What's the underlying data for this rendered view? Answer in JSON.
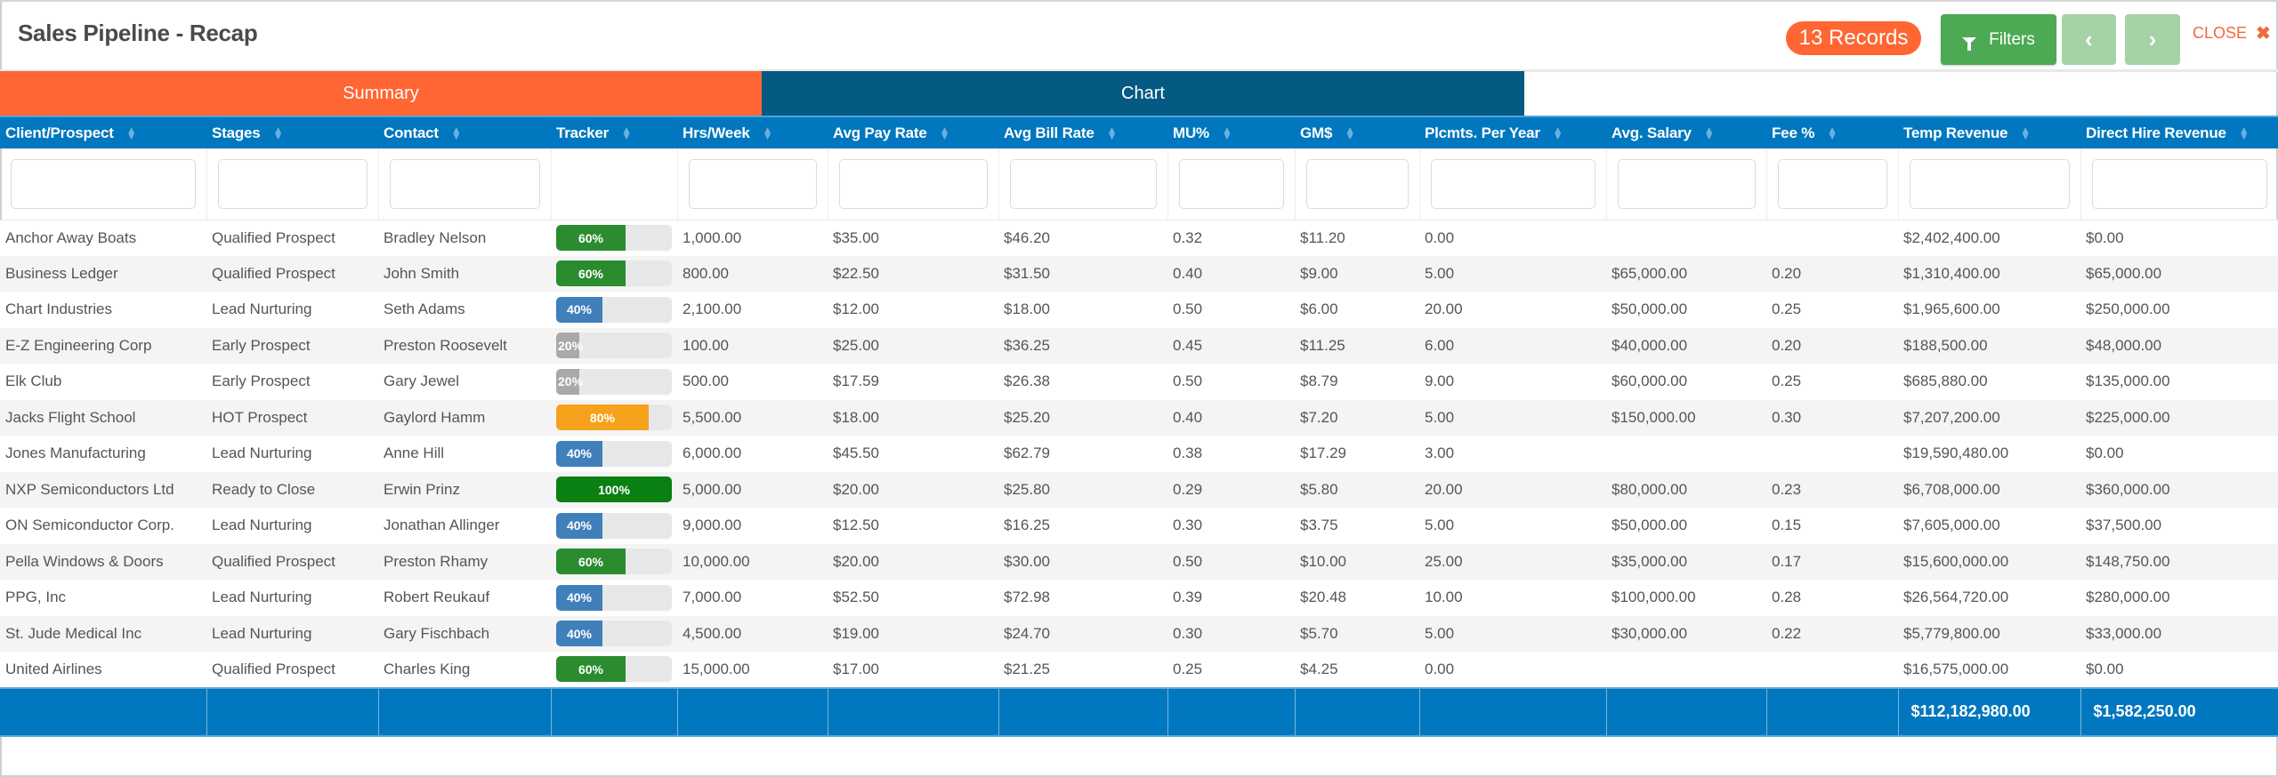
{
  "header": {
    "title": "Sales Pipeline - Recap",
    "records_badge": "13 Records",
    "filters_label": "Filters",
    "prev_glyph": "‹",
    "next_glyph": "›",
    "close_label": "CLOSE",
    "close_glyph": "✖"
  },
  "tabs": [
    {
      "label": "Summary",
      "active": true
    },
    {
      "label": "Chart",
      "active": false
    }
  ],
  "colors": {
    "accent_orange": "#ff6633",
    "chart_tab": "#055a83",
    "table_header": "#0077be",
    "filters_green": "#4caa55",
    "nav_disabled_green": "#a3d3a7"
  },
  "table": {
    "columns": [
      "Client/Prospect",
      "Stages",
      "Contact",
      "Tracker",
      "Hrs/Week",
      "Avg Pay Rate",
      "Avg Bill Rate",
      "MU%",
      "GM$",
      "Plcmts. Per Year",
      "Avg. Salary",
      "Fee %",
      "Temp Revenue",
      "Direct Hire Revenue"
    ],
    "sortable": [
      true,
      true,
      true,
      true,
      true,
      true,
      true,
      true,
      true,
      true,
      true,
      true,
      true,
      true
    ],
    "filter_columns": [
      true,
      true,
      true,
      false,
      true,
      true,
      true,
      true,
      true,
      true,
      true,
      true,
      true,
      true
    ],
    "tracker_colors": {
      "20": "#a9a9a9",
      "40": "#3f7fba",
      "60": "#2a8c2e",
      "80": "#f6a21b",
      "100": "#0a7f12"
    },
    "rows": [
      {
        "client": "Anchor Away Boats",
        "stage": "Qualified Prospect",
        "contact": "Bradley Nelson",
        "tracker": 60,
        "tracker_label": "60%",
        "hrs": "1,000.00",
        "pay": "$35.00",
        "bill": "$46.20",
        "mu": "0.32",
        "gm": "$11.20",
        "plcmts": "0.00",
        "salary": "",
        "fee": "",
        "temp_rev": "$2,402,400.00",
        "dh_rev": "$0.00"
      },
      {
        "client": "Business Ledger",
        "stage": "Qualified Prospect",
        "contact": "John Smith",
        "tracker": 60,
        "tracker_label": "60%",
        "hrs": "800.00",
        "pay": "$22.50",
        "bill": "$31.50",
        "mu": "0.40",
        "gm": "$9.00",
        "plcmts": "5.00",
        "salary": "$65,000.00",
        "fee": "0.20",
        "temp_rev": "$1,310,400.00",
        "dh_rev": "$65,000.00"
      },
      {
        "client": "Chart Industries",
        "stage": "Lead Nurturing",
        "contact": "Seth Adams",
        "tracker": 40,
        "tracker_label": "40%",
        "hrs": "2,100.00",
        "pay": "$12.00",
        "bill": "$18.00",
        "mu": "0.50",
        "gm": "$6.00",
        "plcmts": "20.00",
        "salary": "$50,000.00",
        "fee": "0.25",
        "temp_rev": "$1,965,600.00",
        "dh_rev": "$250,000.00"
      },
      {
        "client": "E-Z Engineering Corp",
        "stage": "Early Prospect",
        "contact": "Preston Roosevelt",
        "tracker": 20,
        "tracker_label": "20%",
        "hrs": "100.00",
        "pay": "$25.00",
        "bill": "$36.25",
        "mu": "0.45",
        "gm": "$11.25",
        "plcmts": "6.00",
        "salary": "$40,000.00",
        "fee": "0.20",
        "temp_rev": "$188,500.00",
        "dh_rev": "$48,000.00"
      },
      {
        "client": "Elk Club",
        "stage": "Early Prospect",
        "contact": "Gary Jewel",
        "tracker": 20,
        "tracker_label": "20%",
        "hrs": "500.00",
        "pay": "$17.59",
        "bill": "$26.38",
        "mu": "0.50",
        "gm": "$8.79",
        "plcmts": "9.00",
        "salary": "$60,000.00",
        "fee": "0.25",
        "temp_rev": "$685,880.00",
        "dh_rev": "$135,000.00"
      },
      {
        "client": "Jacks Flight School",
        "stage": "HOT Prospect",
        "contact": "Gaylord Hamm",
        "tracker": 80,
        "tracker_label": "80%",
        "hrs": "5,500.00",
        "pay": "$18.00",
        "bill": "$25.20",
        "mu": "0.40",
        "gm": "$7.20",
        "plcmts": "5.00",
        "salary": "$150,000.00",
        "fee": "0.30",
        "temp_rev": "$7,207,200.00",
        "dh_rev": "$225,000.00"
      },
      {
        "client": "Jones Manufacturing",
        "stage": "Lead Nurturing",
        "contact": "Anne Hill",
        "tracker": 40,
        "tracker_label": "40%",
        "hrs": "6,000.00",
        "pay": "$45.50",
        "bill": "$62.79",
        "mu": "0.38",
        "gm": "$17.29",
        "plcmts": "3.00",
        "salary": "",
        "fee": "",
        "temp_rev": "$19,590,480.00",
        "dh_rev": "$0.00"
      },
      {
        "client": "NXP Semiconductors Ltd",
        "stage": "Ready to Close",
        "contact": "Erwin Prinz",
        "tracker": 100,
        "tracker_label": "100%",
        "hrs": "5,000.00",
        "pay": "$20.00",
        "bill": "$25.80",
        "mu": "0.29",
        "gm": "$5.80",
        "plcmts": "20.00",
        "salary": "$80,000.00",
        "fee": "0.23",
        "temp_rev": "$6,708,000.00",
        "dh_rev": "$360,000.00"
      },
      {
        "client": "ON Semiconductor Corp.",
        "stage": "Lead Nurturing",
        "contact": "Jonathan Allinger",
        "tracker": 40,
        "tracker_label": "40%",
        "hrs": "9,000.00",
        "pay": "$12.50",
        "bill": "$16.25",
        "mu": "0.30",
        "gm": "$3.75",
        "plcmts": "5.00",
        "salary": "$50,000.00",
        "fee": "0.15",
        "temp_rev": "$7,605,000.00",
        "dh_rev": "$37,500.00"
      },
      {
        "client": "Pella Windows & Doors",
        "stage": "Qualified Prospect",
        "contact": "Preston Rhamy",
        "tracker": 60,
        "tracker_label": "60%",
        "hrs": "10,000.00",
        "pay": "$20.00",
        "bill": "$30.00",
        "mu": "0.50",
        "gm": "$10.00",
        "plcmts": "25.00",
        "salary": "$35,000.00",
        "fee": "0.17",
        "temp_rev": "$15,600,000.00",
        "dh_rev": "$148,750.00"
      },
      {
        "client": "PPG, Inc",
        "stage": "Lead Nurturing",
        "contact": "Robert Reukauf",
        "tracker": 40,
        "tracker_label": "40%",
        "hrs": "7,000.00",
        "pay": "$52.50",
        "bill": "$72.98",
        "mu": "0.39",
        "gm": "$20.48",
        "plcmts": "10.00",
        "salary": "$100,000.00",
        "fee": "0.28",
        "temp_rev": "$26,564,720.00",
        "dh_rev": "$280,000.00"
      },
      {
        "client": "St. Jude Medical Inc",
        "stage": "Lead Nurturing",
        "contact": "Gary Fischbach",
        "tracker": 40,
        "tracker_label": "40%",
        "hrs": "4,500.00",
        "pay": "$19.00",
        "bill": "$24.70",
        "mu": "0.30",
        "gm": "$5.70",
        "plcmts": "5.00",
        "salary": "$30,000.00",
        "fee": "0.22",
        "temp_rev": "$5,779,800.00",
        "dh_rev": "$33,000.00"
      },
      {
        "client": "United Airlines",
        "stage": "Qualified Prospect",
        "contact": "Charles King",
        "tracker": 60,
        "tracker_label": "60%",
        "hrs": "15,000.00",
        "pay": "$17.00",
        "bill": "$21.25",
        "mu": "0.25",
        "gm": "$4.25",
        "plcmts": "0.00",
        "salary": "",
        "fee": "",
        "temp_rev": "$16,575,000.00",
        "dh_rev": "$0.00"
      }
    ],
    "totals": {
      "temp_rev": "$112,182,980.00",
      "dh_rev": "$1,582,250.00"
    }
  }
}
